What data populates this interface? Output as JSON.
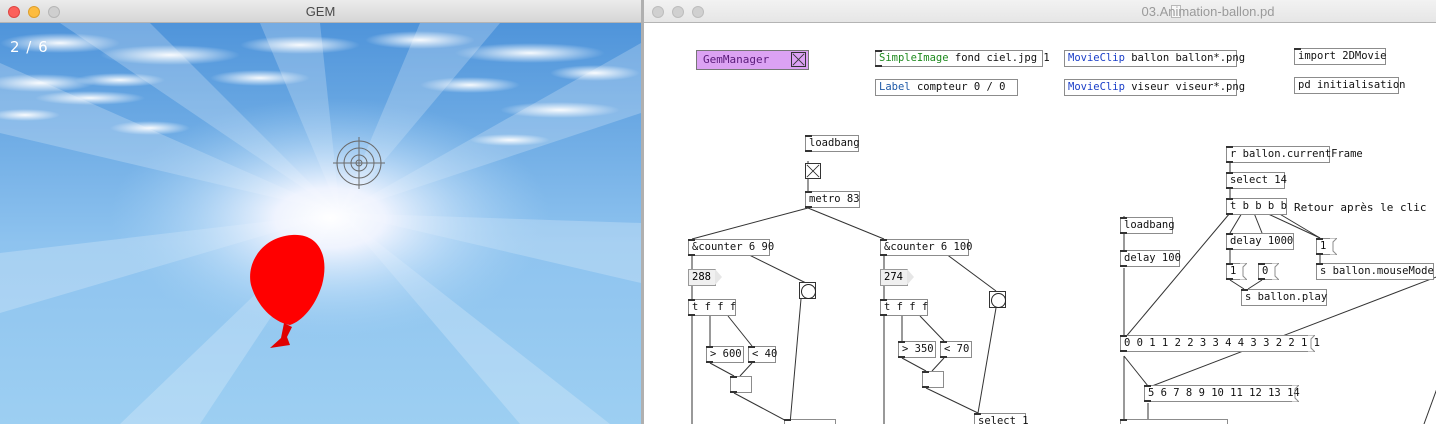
{
  "gem_window": {
    "title": "GEM",
    "counter_text": "2 / 6"
  },
  "pd_window": {
    "title": "03.Animation-ballon.pd",
    "objects": {
      "gemmanager": "GemManager",
      "simpleimage_kw": "SimpleImage",
      "simpleimage_args": "fond ciel.jpg 1",
      "label_kw": "Label",
      "label_args": "compteur 0 / 0",
      "movieclip1_kw": "MovieClip",
      "movieclip1_args": "ballon ballon*.png",
      "movieclip2_kw": "MovieClip",
      "movieclip2_args": "viseur viseur*.png",
      "import": "import 2DMovie",
      "pd_init": "pd initialisation",
      "loadbang1": "loadbang",
      "metro": "metro 83",
      "counter1": "&counter 6 90",
      "counter2": "&counter 6 100",
      "num1": "288",
      "num2": "274",
      "tfff1": "t f f f",
      "tfff2": "t f f f",
      "gt600": "> 600",
      "lt40": "< 40",
      "gt350": "> 350",
      "lt70": "< 70",
      "select1": "select 1",
      "r_frame": "r ballon.currentFrame",
      "select14": "select 14",
      "tbbbb": "t b b b b",
      "retour_comment": "Retour après le clic",
      "delay1000": "delay 1000",
      "msg1a": "1",
      "msg0": "0",
      "msg1b": "1",
      "s_play": "s ballon.play",
      "s_mouse": "s ballon.mouseMode",
      "loadbang2": "loadbang",
      "delay100": "delay 100",
      "seq1": "0 0 1 1 2 2 3 3 4 4 3 3 2 2 1 1",
      "seq2": "5 6 7 8 9 10 11 12 13 14"
    }
  },
  "colors": {
    "gemmanager_bg": "#dca2f3",
    "balloon": "#ff0000",
    "sky_top": "#5d9edc",
    "keyword_green": "#1f8a1f",
    "keyword_blue": "#1a3ec8"
  }
}
